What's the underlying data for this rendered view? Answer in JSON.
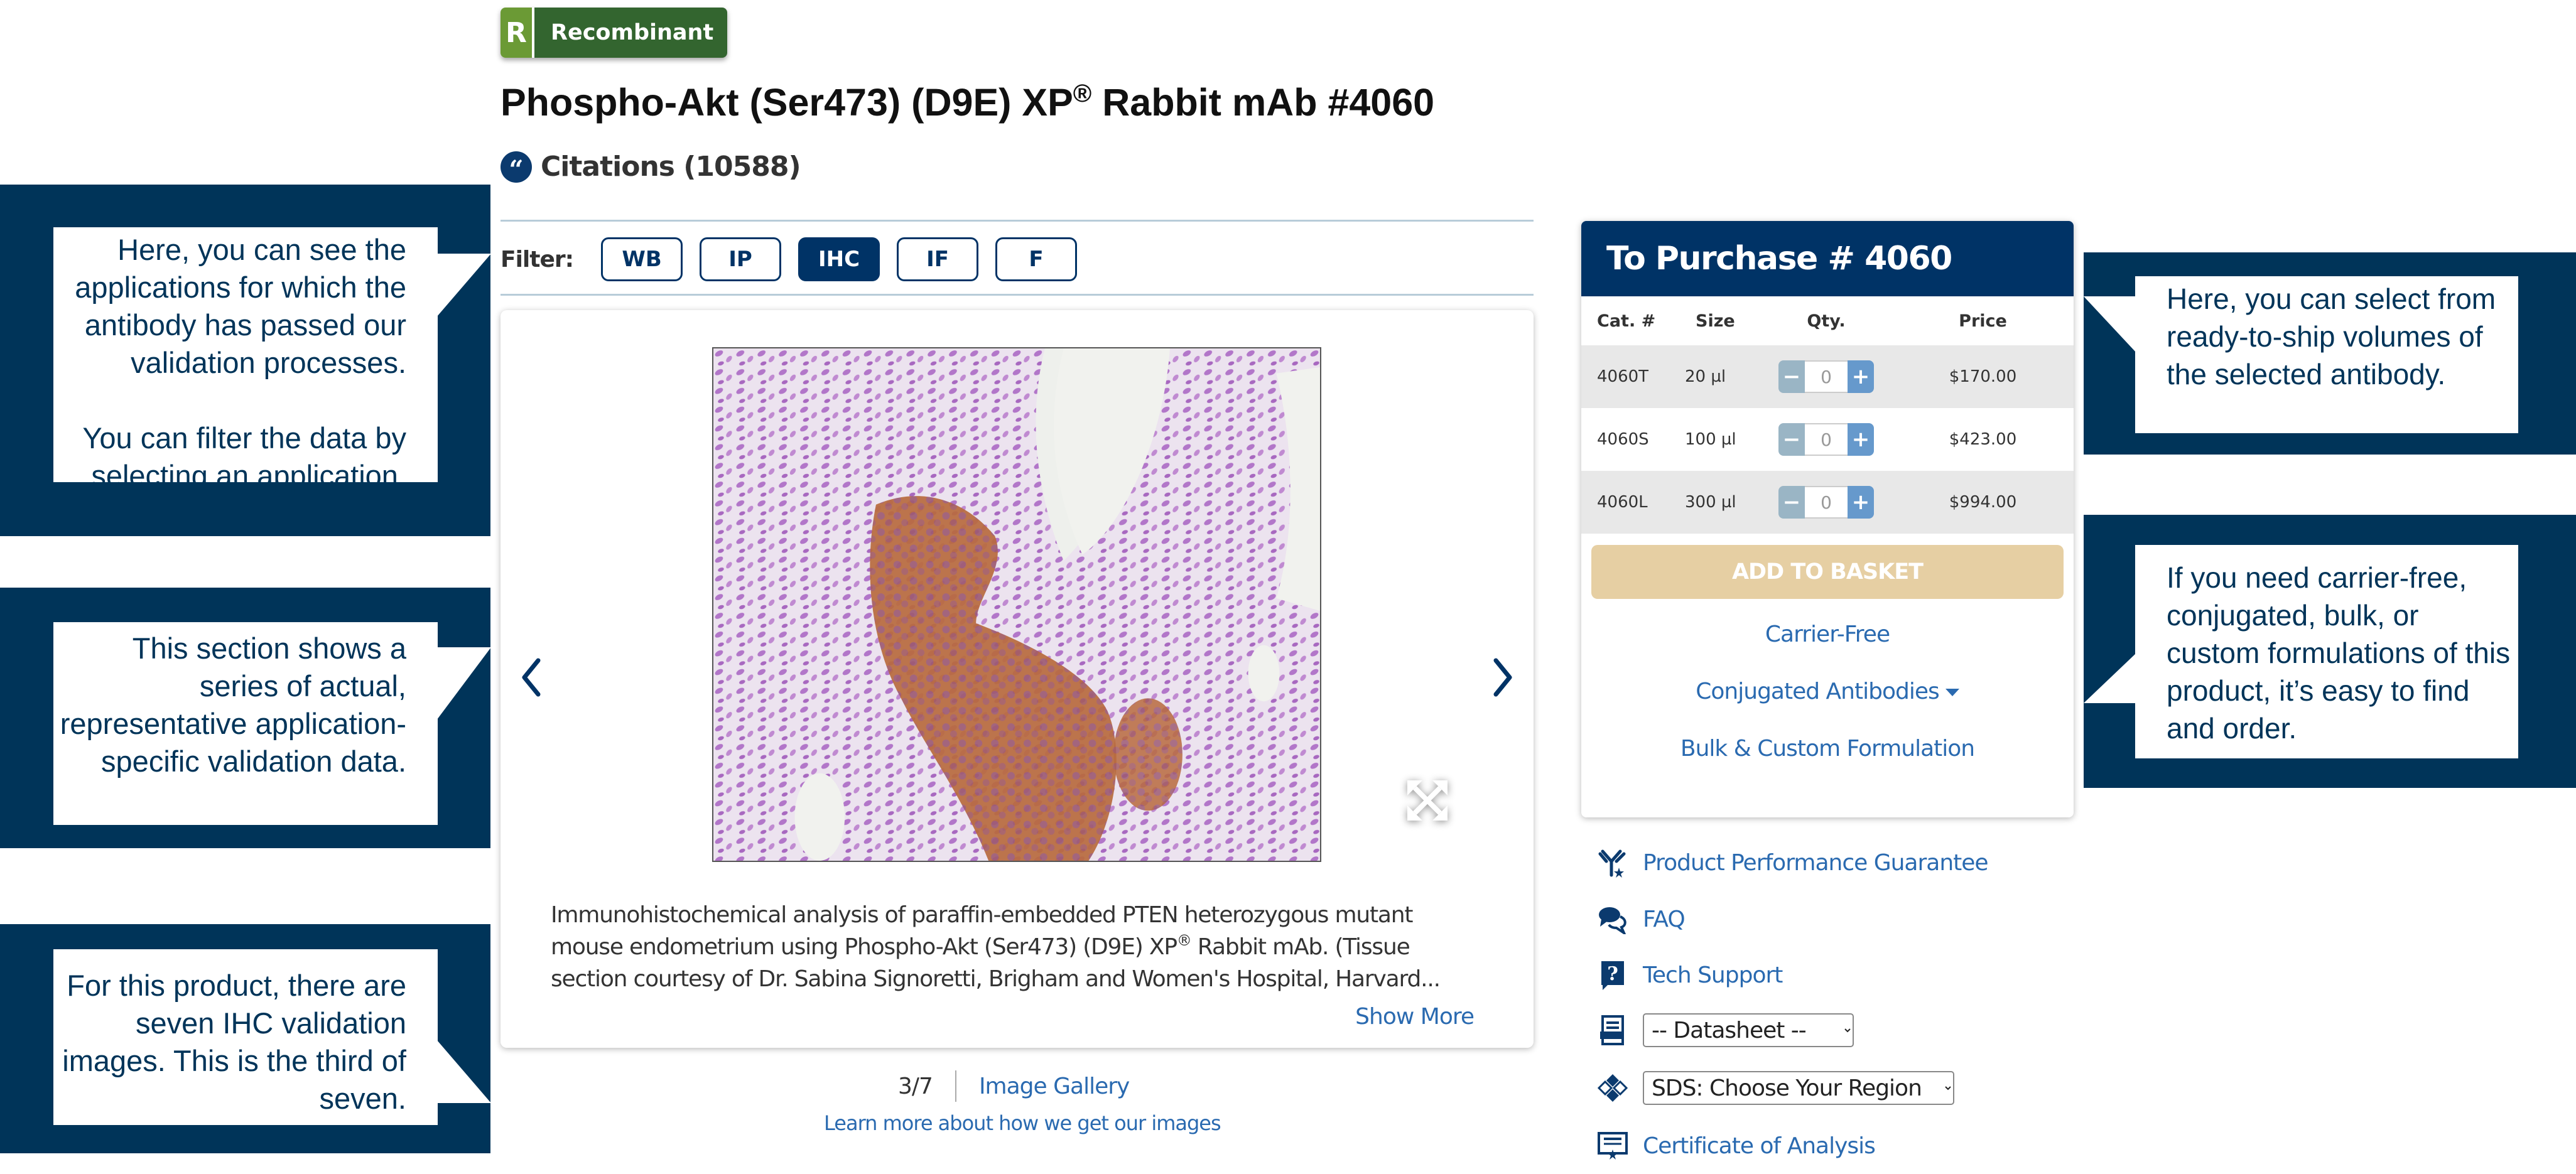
{
  "badge": {
    "letter": "R",
    "label": "Recombinant",
    "colors": {
      "letter_bg": "#6b9a35",
      "label_bg": "#33652f"
    }
  },
  "product": {
    "title_main": "Phospho-Akt (Ser473) (D9E) XP",
    "title_reg": "®",
    "title_tail": " Rabbit mAb #4060",
    "citations_label": "Citations (10588)",
    "citations_icon": "quote-icon"
  },
  "filter": {
    "label": "Filter:",
    "options": [
      {
        "label": "WB",
        "active": false
      },
      {
        "label": "IP",
        "active": false
      },
      {
        "label": "IHC",
        "active": true
      },
      {
        "label": "IF",
        "active": false
      },
      {
        "label": "F",
        "active": false
      }
    ]
  },
  "gallery": {
    "prev_icon": "chevron-left-icon",
    "next_icon": "chevron-right-icon",
    "expand_icon": "expand-icon",
    "caption_part1": "Immunohistochemical analysis of paraffin-embedded PTEN heterozygous mutant mouse endometrium using Phospho-Akt (Ser473) (D9E) XP",
    "caption_reg": "®",
    "caption_part2": " Rabbit mAb. (Tissue section courtesy of Dr. Sabina Signoretti, Brigham and Women's Hospital, Harvard...",
    "show_more": "Show More",
    "current": 3,
    "total": 7,
    "counter": "3/7",
    "gallery_link": "Image Gallery",
    "learn_more": "Learn more about how we get our images"
  },
  "purchase": {
    "title": "To Purchase # 4060",
    "columns": [
      "Cat. #",
      "Size",
      "Qty.",
      "Price"
    ],
    "rows": [
      {
        "cat": "4060T",
        "size": "20 µl",
        "qty": "0",
        "price": "$170.00"
      },
      {
        "cat": "4060S",
        "size": "100 µl",
        "qty": "0",
        "price": "$423.00"
      },
      {
        "cat": "4060L",
        "size": "300 µl",
        "qty": "0",
        "price": "$994.00"
      }
    ],
    "minus": "−",
    "plus": "+",
    "add_to_basket": "ADD TO BASKET",
    "links": {
      "carrier_free": "Carrier-Free",
      "conjugated": "Conjugated Antibodies",
      "bulk": "Bulk & Custom Formulation"
    },
    "colors": {
      "header": "#003366",
      "basket": "#e6cfa3",
      "link": "#2a6ab0"
    }
  },
  "resources": {
    "guarantee": "Product Performance Guarantee",
    "faq": "FAQ",
    "tech_support": "Tech Support",
    "datasheet_select": "-- Datasheet --",
    "sds_select": "SDS: Choose Your Region",
    "coa": "Certificate of Analysis"
  },
  "callouts": {
    "applications": "Here, you can see the applications for which the antibody has passed our validation processes.",
    "applications_2": "You can filter the data by selecting an application.",
    "validation": "This section shows a series of actual, representative application-specific validation data.",
    "count": "For this product, there are seven IHC validation images. This is the third of seven.",
    "volumes": "Here, you can select from ready-to-ship volumes of the selected antibody.",
    "formulations": "If you need carrier-free, conjugated, bulk, or custom formulations of this product, it’s easy to find and order.",
    "color": "#003459"
  }
}
